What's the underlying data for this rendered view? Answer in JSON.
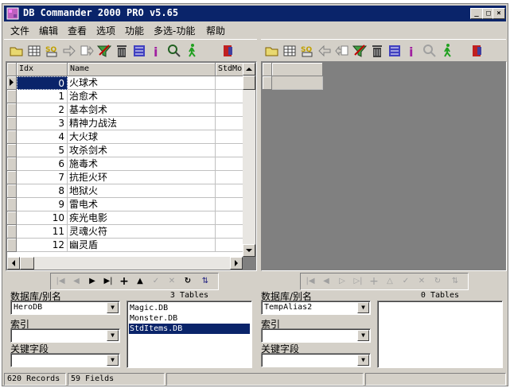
{
  "window": {
    "title": "DB Commander 2000 PRO v5.65",
    "controls": [
      "minimize",
      "maximize",
      "close"
    ]
  },
  "menu": [
    "文件",
    "编辑",
    "查看",
    "选项",
    "功能",
    "多选-功能",
    "帮助"
  ],
  "left_toolbar_icons": [
    "open-folder-icon",
    "table-icon",
    "sql-icon",
    "arrow-right-icon",
    "copy-right-icon",
    "filter-icon",
    "trash-icon",
    "structure-icon",
    "info-icon",
    "search-icon",
    "run-icon",
    "exit-icon"
  ],
  "right_toolbar_icons": [
    "open-folder-icon",
    "table-icon",
    "sql-icon",
    "arrow-left-icon",
    "copy-left-icon",
    "filter-icon",
    "trash-icon",
    "structure-icon",
    "info-icon",
    "search-icon",
    "run-icon",
    "exit-icon"
  ],
  "left_grid": {
    "columns": [
      "Idx",
      "Name",
      "StdMo"
    ],
    "rows": [
      {
        "idx": "0",
        "name": "火球术"
      },
      {
        "idx": "1",
        "name": "治愈术"
      },
      {
        "idx": "2",
        "name": "基本剑术"
      },
      {
        "idx": "3",
        "name": "精神力战法"
      },
      {
        "idx": "4",
        "name": "大火球"
      },
      {
        "idx": "5",
        "name": "攻杀剑术"
      },
      {
        "idx": "6",
        "name": "施毒术"
      },
      {
        "idx": "7",
        "name": "抗拒火环"
      },
      {
        "idx": "8",
        "name": "地狱火"
      },
      {
        "idx": "9",
        "name": "雷电术"
      },
      {
        "idx": "10",
        "name": "疾光电影"
      },
      {
        "idx": "11",
        "name": "灵魂火符"
      },
      {
        "idx": "12",
        "name": "幽灵盾"
      }
    ],
    "selected_row": 0
  },
  "left_panel": {
    "db_label": "数据库/别名",
    "db_value": "HeroDB",
    "index_label": "索引",
    "index_value": "",
    "key_label": "关键字段",
    "key_value": "",
    "tables_count": "3 Tables",
    "tables": [
      "Magic.DB",
      "Monster.DB",
      "StdItems.DB"
    ],
    "selected_table": 2
  },
  "right_panel": {
    "db_label": "数据库/别名",
    "db_value": "TempAlias2",
    "index_label": "索引",
    "index_value": "",
    "key_label": "关键字段",
    "key_value": "",
    "tables_count": "0 Tables",
    "tables": []
  },
  "status": {
    "records": "620 Records",
    "fields": "59 Fields"
  }
}
